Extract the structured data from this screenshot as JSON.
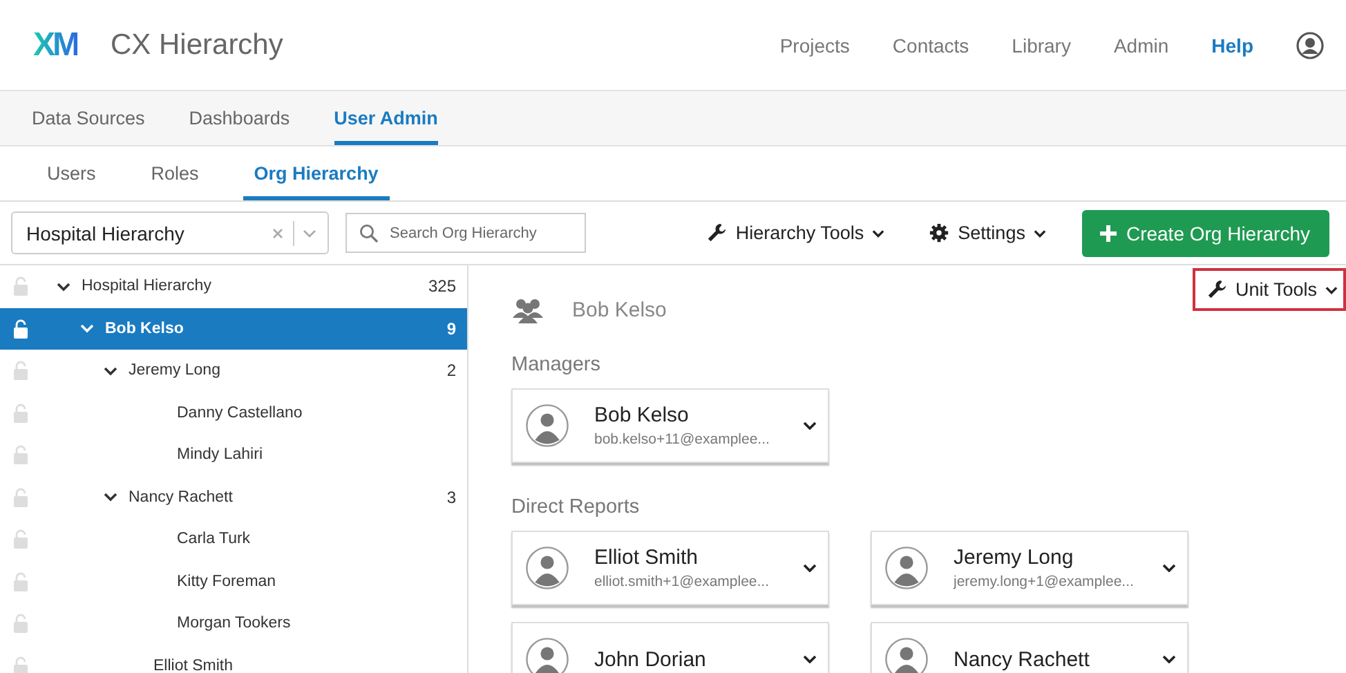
{
  "header": {
    "logo": "XM",
    "title": "CX Hierarchy",
    "nav": [
      {
        "label": "Projects",
        "selected": false
      },
      {
        "label": "Contacts",
        "selected": false
      },
      {
        "label": "Library",
        "selected": false
      },
      {
        "label": "Admin",
        "selected": false
      },
      {
        "label": "Help",
        "selected": true
      }
    ]
  },
  "main_tabs": [
    {
      "label": "Data Sources",
      "selected": false
    },
    {
      "label": "Dashboards",
      "selected": false
    },
    {
      "label": "User Admin",
      "selected": true
    }
  ],
  "sub_tabs": [
    {
      "label": "Users",
      "selected": false
    },
    {
      "label": "Roles",
      "selected": false
    },
    {
      "label": "Org Hierarchy",
      "selected": true
    }
  ],
  "toolbar": {
    "hierarchy_select": "Hospital Hierarchy",
    "search": {
      "placeholder": "Search Org Hierarchy"
    },
    "hierarchy_tools": "Hierarchy Tools",
    "settings": "Settings",
    "create_button": "Create Org Hierarchy"
  },
  "tree": [
    {
      "label": "Hospital Hierarchy",
      "count": "325",
      "selected": false,
      "expanded": true,
      "children": [
        {
          "label": "Bob Kelso",
          "count": "9",
          "selected": true,
          "expanded": true,
          "children": [
            {
              "label": "Jeremy Long",
              "count": "2",
              "selected": false,
              "expanded": true,
              "children": [
                {
                  "label": "Danny Castellano",
                  "selected": false
                },
                {
                  "label": "Mindy Lahiri",
                  "selected": false
                }
              ]
            },
            {
              "label": "Nancy Rachett",
              "count": "3",
              "selected": false,
              "expanded": true,
              "children": [
                {
                  "label": "Carla Turk",
                  "selected": false
                },
                {
                  "label": "Kitty Foreman",
                  "selected": false
                },
                {
                  "label": "Morgan Tookers",
                  "selected": false
                }
              ]
            },
            {
              "label": "Elliot Smith",
              "selected": false
            }
          ]
        }
      ]
    }
  ],
  "unit": {
    "name": "Bob Kelso",
    "unit_tools": {
      "label": "Unit Tools",
      "highlighted": true
    },
    "sections": [
      {
        "title": "Managers",
        "people": [
          {
            "name": "Bob Kelso",
            "email": "bob.kelso+11@examplee..."
          }
        ]
      },
      {
        "title": "Direct Reports",
        "people": [
          {
            "name": "Elliot Smith",
            "email": "elliot.smith+1@examplee..."
          },
          {
            "name": "Jeremy Long",
            "email": "jeremy.long+1@examplee..."
          },
          {
            "name": "John Dorian"
          },
          {
            "name": "Nancy Rachett"
          }
        ]
      }
    ]
  }
}
